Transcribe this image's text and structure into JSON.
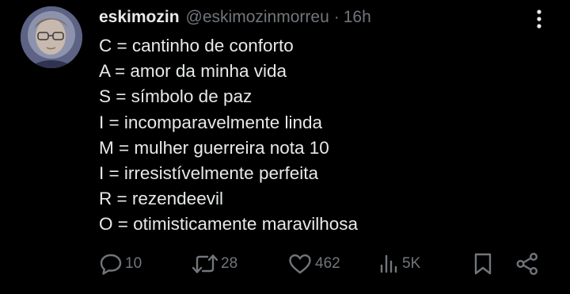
{
  "tweet": {
    "author": {
      "display_name": "eskimozin",
      "handle": "@eskimozinmorreu",
      "separator": "·",
      "time": "16h"
    },
    "lines": [
      "C = cantinho de conforto",
      "A = amor da minha vida",
      "S = símbolo de paz",
      "I = incomparavelmente linda",
      "M = mulher guerreira nota 10",
      "I = irresistívelmente perfeita",
      "R = rezendeevil",
      "O = otimisticamente maravilhosa"
    ],
    "actions": {
      "replies": "10",
      "reposts": "28",
      "likes": "462",
      "views": "5K"
    },
    "icons": {
      "more": "more-vertical-icon",
      "reply": "reply-icon",
      "repost": "repost-icon",
      "like": "heart-icon",
      "views": "views-icon",
      "bookmark": "bookmark-icon",
      "share": "share-icon"
    }
  },
  "colors": {
    "background": "#000000",
    "primary_text": "#e7e9ea",
    "secondary_text": "#71767b"
  }
}
